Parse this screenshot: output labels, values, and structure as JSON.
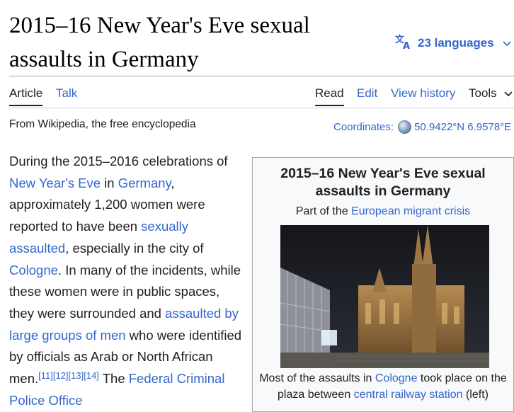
{
  "page": {
    "title": "2015–16 New Year's Eve sexual assaults in Germany",
    "languages_label": "23 languages",
    "tagline": "From Wikipedia, the free encyclopedia",
    "coordinates_label": "Coordinates:",
    "coordinates_value": "50.9422°N 6.9578°E"
  },
  "tabs": {
    "article": "Article",
    "talk": "Talk",
    "read": "Read",
    "edit": "Edit",
    "view_history": "View history",
    "tools": "Tools"
  },
  "body": {
    "t1": "During the 2015–2016 celebrations of ",
    "l1": "New Year's Eve",
    "t2": " in ",
    "l2": "Germany",
    "t3": ", approximately 1,200 women were reported to have been ",
    "l3": "sexually assaulted",
    "t4": ", especially in the city of ",
    "l4": "Cologne",
    "t5": ". In many of the incidents, while these women were in public spaces, they were surrounded and ",
    "l5": "assaulted by large groups of men",
    "t6": " who were identified by officials as Arab or North African men.",
    "refs": [
      "[11]",
      "[12]",
      "[13]",
      "[14]"
    ],
    "t7": " The ",
    "l6": "Federal Criminal Police Office"
  },
  "infobox": {
    "title": "2015–16 New Year's Eve sexual assaults in Germany",
    "part_prefix": "Part of the ",
    "part_link": "European migrant crisis",
    "caption_t1": "Most of the assaults in ",
    "caption_l1": "Cologne",
    "caption_t2": " took place on the plaza between ",
    "caption_l2": "central railway station",
    "caption_t3": " (left)"
  },
  "colors": {
    "link": "#3366cc",
    "text": "#202122",
    "border": "#a2a9b1"
  },
  "icons": [
    "translate-icon",
    "chevron-down-icon",
    "globe-icon"
  ]
}
